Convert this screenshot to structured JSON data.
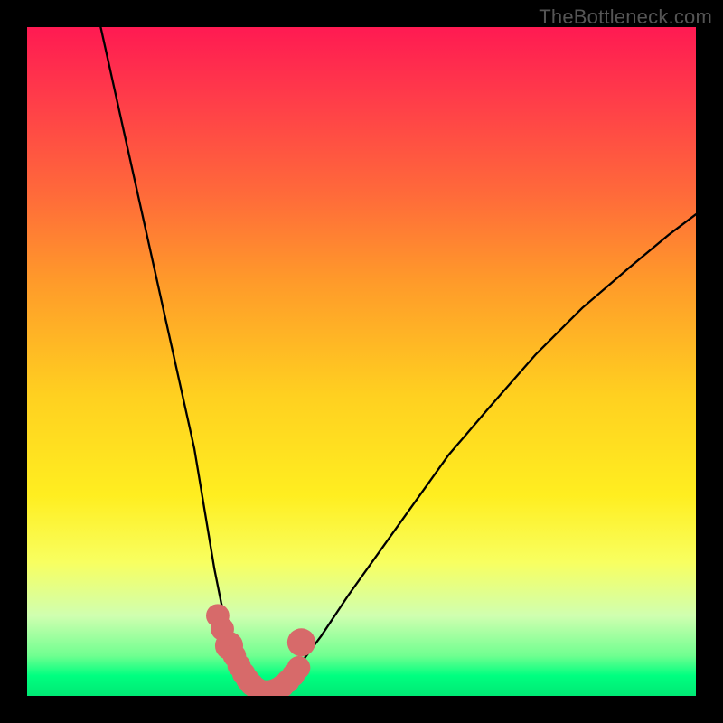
{
  "watermark": "TheBottleneck.com",
  "chart_data": {
    "type": "line",
    "title": "",
    "xlabel": "",
    "ylabel": "",
    "xlim": [
      0,
      100
    ],
    "ylim": [
      0,
      100
    ],
    "series": [
      {
        "name": "left-curve",
        "x": [
          11,
          13,
          15,
          17,
          19,
          21,
          23,
          25,
          26,
          27,
          28,
          29,
          30,
          31,
          32,
          33,
          34,
          35
        ],
        "y": [
          100,
          91,
          82,
          73,
          64,
          55,
          46,
          37,
          31,
          25,
          19,
          14,
          10,
          7,
          4.5,
          2.8,
          1.5,
          0.5
        ]
      },
      {
        "name": "right-curve",
        "x": [
          35,
          37,
          39,
          41,
          44,
          48,
          53,
          58,
          63,
          69,
          76,
          83,
          90,
          96,
          100
        ],
        "y": [
          0.5,
          1.3,
          2.8,
          5,
          9,
          15,
          22,
          29,
          36,
          43,
          51,
          58,
          64,
          69,
          72
        ]
      }
    ],
    "markers": [
      {
        "name": "red-dot",
        "x": 28.5,
        "y": 12,
        "r": 1.0
      },
      {
        "name": "red-dot",
        "x": 29.2,
        "y": 10,
        "r": 1.0
      },
      {
        "name": "red-dot",
        "x": 30.2,
        "y": 7.5,
        "r": 1.3
      },
      {
        "name": "red-dot",
        "x": 31.0,
        "y": 6.0,
        "r": 1.0
      },
      {
        "name": "red-dot",
        "x": 31.7,
        "y": 4.5,
        "r": 1.0
      },
      {
        "name": "red-dot",
        "x": 32.4,
        "y": 3.3,
        "r": 1.0
      },
      {
        "name": "red-dot",
        "x": 33.0,
        "y": 2.4,
        "r": 1.0
      },
      {
        "name": "red-dot",
        "x": 33.6,
        "y": 1.7,
        "r": 1.0
      },
      {
        "name": "red-dot",
        "x": 34.3,
        "y": 1.1,
        "r": 1.0
      },
      {
        "name": "red-dot",
        "x": 35.0,
        "y": 0.7,
        "r": 1.0
      },
      {
        "name": "red-dot",
        "x": 35.8,
        "y": 0.6,
        "r": 1.0
      },
      {
        "name": "red-dot",
        "x": 36.6,
        "y": 0.7,
        "r": 1.0
      },
      {
        "name": "red-dot",
        "x": 37.4,
        "y": 1.0,
        "r": 1.0
      },
      {
        "name": "red-dot",
        "x": 38.2,
        "y": 1.5,
        "r": 1.0
      },
      {
        "name": "red-dot",
        "x": 39.0,
        "y": 2.2,
        "r": 1.0
      },
      {
        "name": "red-dot",
        "x": 39.8,
        "y": 3.1,
        "r": 1.0
      },
      {
        "name": "red-dot",
        "x": 40.6,
        "y": 4.2,
        "r": 1.0
      },
      {
        "name": "red-dot",
        "x": 41.0,
        "y": 8.0,
        "r": 1.3
      }
    ],
    "marker_color": "#d76a6a"
  }
}
